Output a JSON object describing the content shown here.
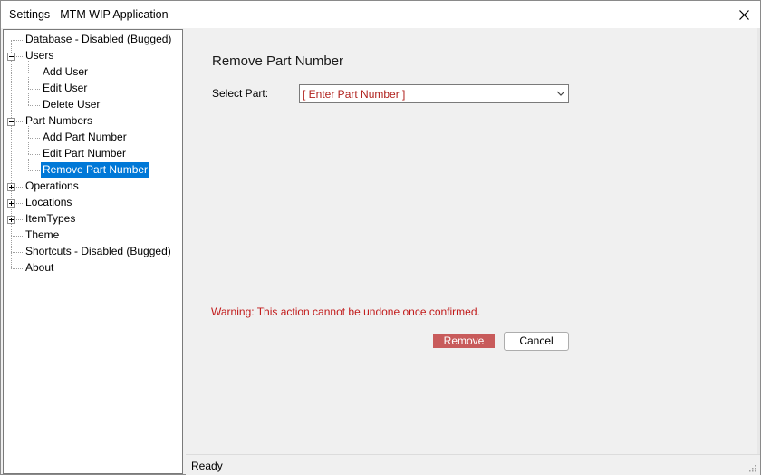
{
  "window": {
    "title": "Settings - MTM WIP Application"
  },
  "tree": {
    "items": [
      {
        "label": "Database - Disabled (Bugged)",
        "level": 0,
        "expander": "none"
      },
      {
        "label": "Users",
        "level": 0,
        "expander": "minus"
      },
      {
        "label": "Add User",
        "level": 1,
        "expander": "none"
      },
      {
        "label": "Edit User",
        "level": 1,
        "expander": "none"
      },
      {
        "label": "Delete User",
        "level": 1,
        "expander": "none"
      },
      {
        "label": "Part Numbers",
        "level": 0,
        "expander": "minus"
      },
      {
        "label": "Add Part Number",
        "level": 1,
        "expander": "none"
      },
      {
        "label": "Edit Part Number",
        "level": 1,
        "expander": "none"
      },
      {
        "label": "Remove Part Number",
        "level": 1,
        "expander": "none",
        "selected": true
      },
      {
        "label": "Operations",
        "level": 0,
        "expander": "plus"
      },
      {
        "label": "Locations",
        "level": 0,
        "expander": "plus"
      },
      {
        "label": "ItemTypes",
        "level": 0,
        "expander": "plus"
      },
      {
        "label": "Theme",
        "level": 0,
        "expander": "none"
      },
      {
        "label": "Shortcuts - Disabled (Bugged)",
        "level": 0,
        "expander": "none"
      },
      {
        "label": "About",
        "level": 0,
        "expander": "none"
      }
    ]
  },
  "main": {
    "title": "Remove Part Number",
    "select_label": "Select Part:",
    "select_value": "[ Enter Part Number ]",
    "warning": "Warning: This action cannot be undone once confirmed.",
    "remove_label": "Remove",
    "cancel_label": "Cancel"
  },
  "statusbar": {
    "text": "Ready"
  },
  "colors": {
    "accent": "#0078d7",
    "warning": "#c11a1a",
    "remove_button": "#c85b5b",
    "placeholder": "#b0211d"
  },
  "icons": {
    "close": "close-icon",
    "dropdown": "chevron-down-icon",
    "grip": "resize-grip-icon",
    "expand": "plus-box-icon",
    "collapse": "minus-box-icon"
  }
}
